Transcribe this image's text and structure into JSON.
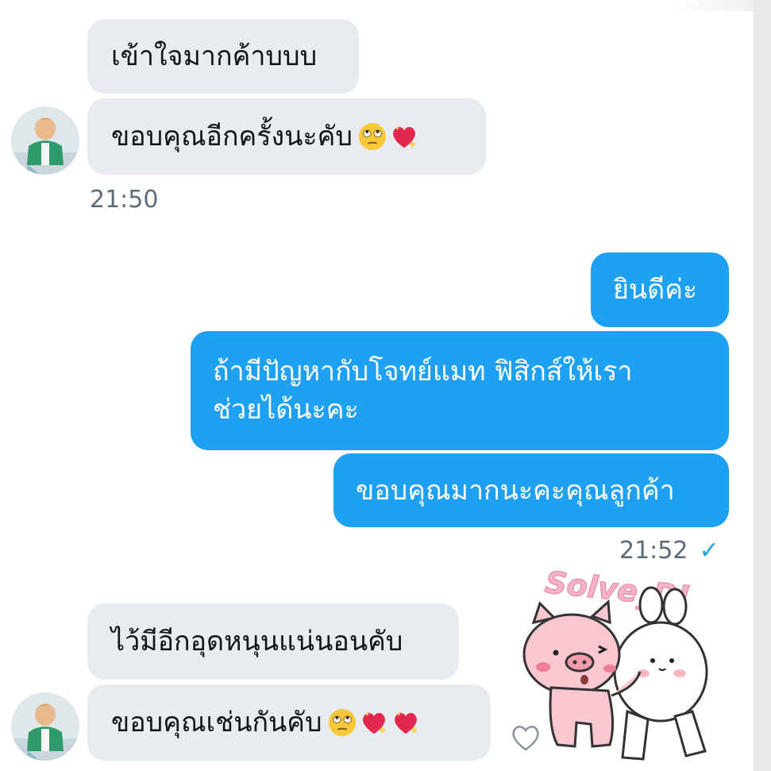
{
  "messages": {
    "incoming_1": "เข้าใจมากค้าบบบ",
    "incoming_2": "ขอบคุณอีกครั้งนะคับ",
    "time_1": "21:50",
    "outgoing_1": "ยินดีค่ะ",
    "outgoing_2": "ถ้ามีปัญหากับโจทย์แมท ฟิสิกส์ให้เรา\nช่วยได้นะคะ",
    "outgoing_3": "ขอบคุณมากนะคะคุณลูกค้า",
    "time_2": "21:52",
    "read_mark": "✓",
    "incoming_3": "ไว้มีอีกอุดหนุนแน่นอนคับ",
    "incoming_4": "ขอบคุณเช่นกันคับ"
  },
  "sticker": {
    "watermark": "Solve_DI"
  },
  "colors": {
    "outgoing_bubble": "#1ea1f2",
    "incoming_bubble": "#e8ecf0",
    "timestamp": "#5b6b78"
  },
  "icons": [
    "rolling-eyes-emoji",
    "sparkling-heart-emoji",
    "like-heart-icon",
    "read-check-icon"
  ]
}
